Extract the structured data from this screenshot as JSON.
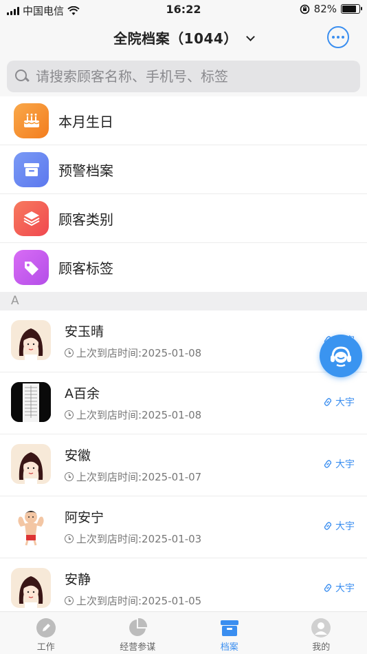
{
  "status_bar": {
    "carrier": "中国电信",
    "time": "16:22",
    "battery": "82%",
    "battery_level": 0.82
  },
  "header": {
    "title": "全院档案（1044）",
    "more_icon": "more-dots-icon"
  },
  "search": {
    "placeholder": "请搜索顾客名称、手机号、标签"
  },
  "menu": [
    {
      "label": "本月生日",
      "icon": "cake-icon",
      "color": "#f7962f"
    },
    {
      "label": "预警档案",
      "icon": "archive-box-icon",
      "color": "#6e8cf2"
    },
    {
      "label": "顾客类别",
      "icon": "layers-icon",
      "color": "#f5605a"
    },
    {
      "label": "顾客标签",
      "icon": "tag-icon",
      "color": "#c85ef0"
    }
  ],
  "section": {
    "letter": "A"
  },
  "customers": [
    {
      "name": "安玉晴",
      "visit": "上次到店时间:2025-01-08",
      "staff": "大宇",
      "avatar": "cartoon-girl-avatar"
    },
    {
      "name": "A百余",
      "visit": "上次到店时间:2025-01-08",
      "staff": "大宇",
      "avatar": "document-photo-avatar"
    },
    {
      "name": "安徽",
      "visit": "上次到店时间:2025-01-07",
      "staff": "大宇",
      "avatar": "cartoon-girl-avatar"
    },
    {
      "name": "阿安宁",
      "visit": "上次到店时间:2025-01-03",
      "staff": "大宇",
      "avatar": "muscle-cartoon-avatar"
    },
    {
      "name": "安静",
      "visit": "上次到店时间:2025-01-05",
      "staff": "大宇",
      "avatar": "cartoon-girl-avatar"
    }
  ],
  "tabbar": [
    {
      "label": "工作",
      "icon": "pencil-icon",
      "active": false
    },
    {
      "label": "经营参谋",
      "icon": "pie-chart-icon",
      "active": false
    },
    {
      "label": "档案",
      "icon": "archive-box-icon",
      "active": true
    },
    {
      "label": "我的",
      "icon": "user-icon",
      "active": false
    }
  ],
  "colors": {
    "accent": "#3a8ef0"
  }
}
